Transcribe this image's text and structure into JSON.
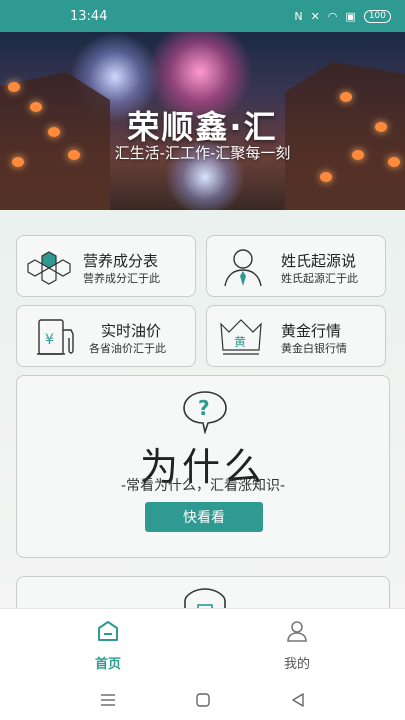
{
  "status_bar": {
    "time": "13:44",
    "battery": "100"
  },
  "hero": {
    "title": "荣顺鑫·汇",
    "subtitle": "汇生活-汇工作-汇聚每一刻"
  },
  "cards": [
    {
      "title": "营养成分表",
      "subtitle": "营养成分汇于此",
      "icon": "hexagon-grid-icon"
    },
    {
      "title": "姓氏起源说",
      "subtitle": "姓氏起源汇于此",
      "icon": "person-icon"
    },
    {
      "title": "实时油价",
      "subtitle": "各省油价汇于此",
      "icon": "fuel-pump-icon",
      "icon_text": "¥"
    },
    {
      "title": "黄金行情",
      "subtitle": "黄金白银行情",
      "icon": "gold-crown-icon",
      "icon_text": "黄"
    }
  ],
  "feature": {
    "title": "为什么",
    "slogan": "-常看为什么，汇看涨知识-",
    "button": "快看看",
    "icon": "question-bubble-icon",
    "icon_text": "?"
  },
  "tabbar": {
    "home_label": "首页",
    "mine_label": "我的"
  },
  "colors": {
    "accent": "#2e9a91"
  }
}
